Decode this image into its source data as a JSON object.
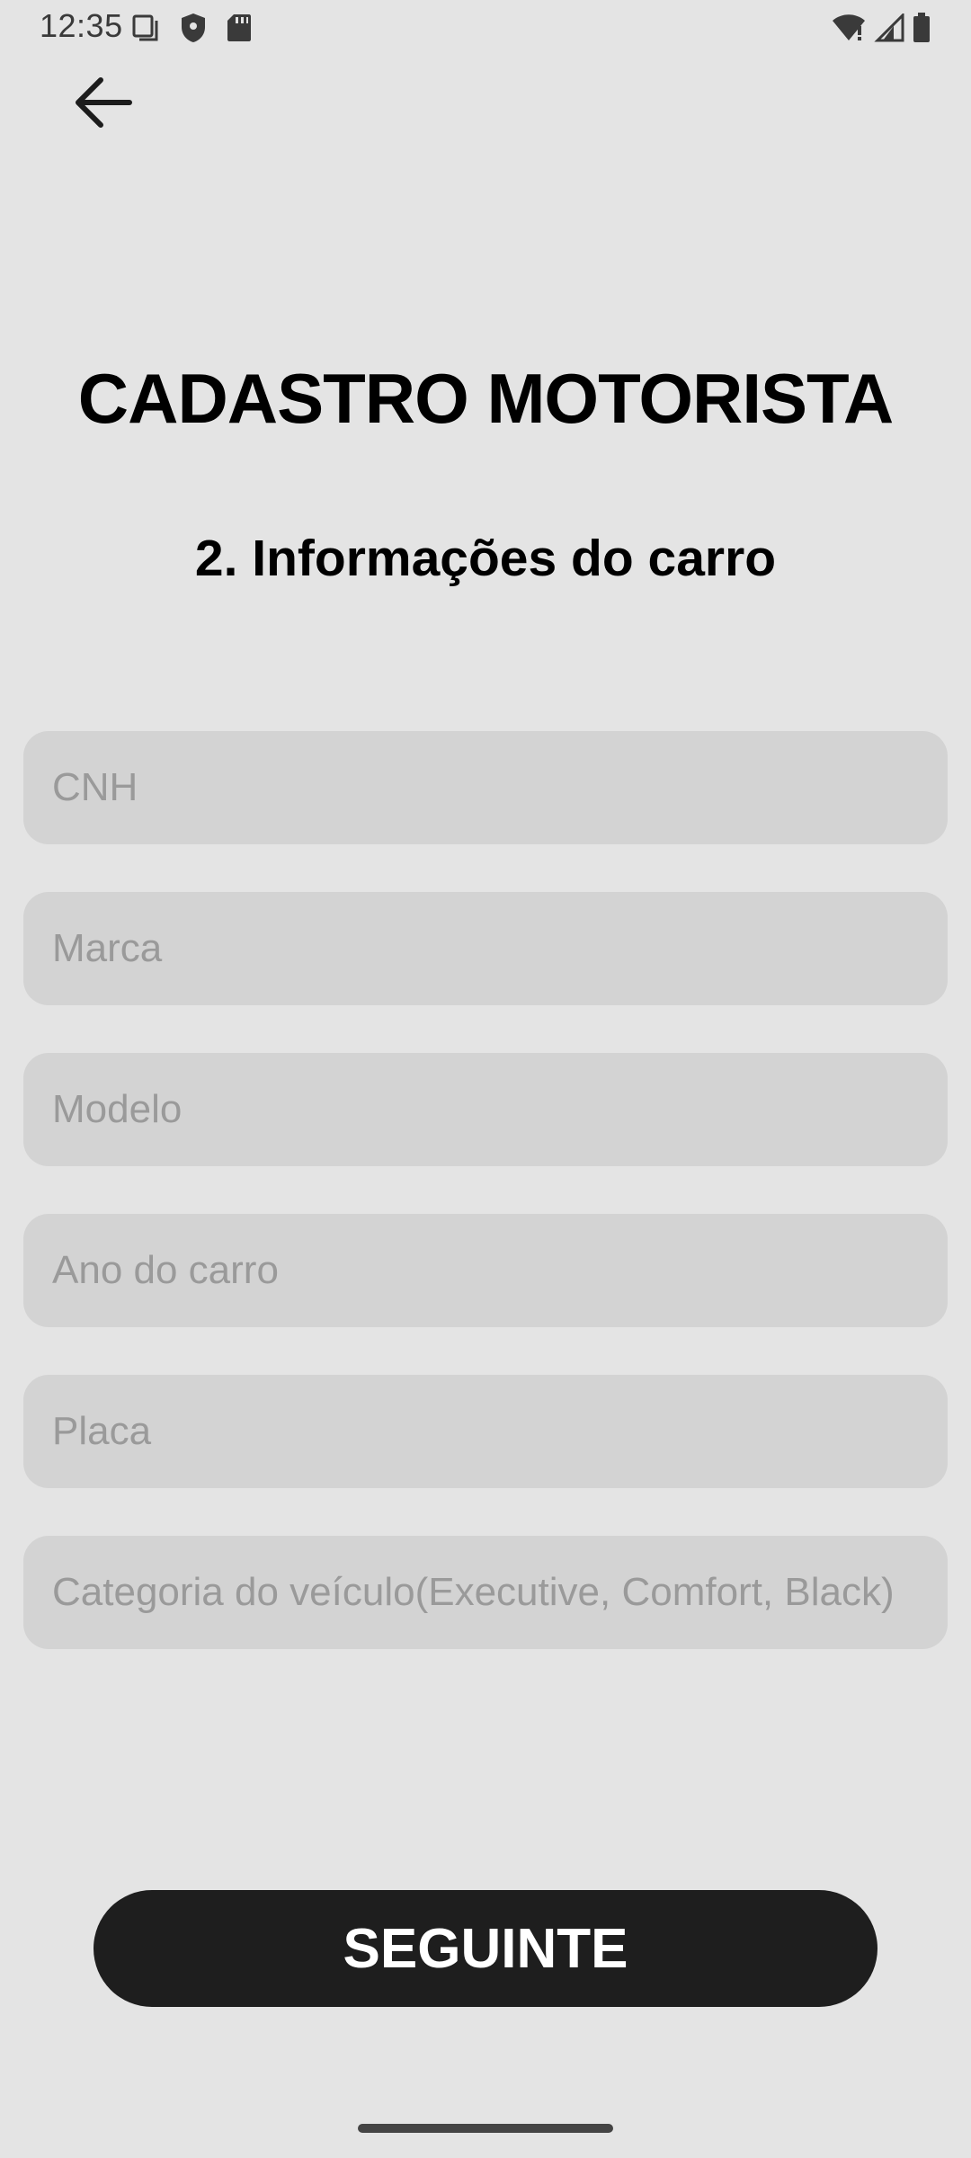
{
  "status_bar": {
    "time": "12:35",
    "left_icons": [
      "copy-icon",
      "shield-icon",
      "sd-card-icon"
    ],
    "right_icons": [
      "wifi-alert-icon",
      "signal-icon",
      "battery-icon"
    ]
  },
  "header": {
    "back_icon": "arrow-left-icon"
  },
  "title": "CADASTRO MOTORISTA",
  "subtitle": "2. Informações do carro",
  "form": {
    "cnh_placeholder": "CNH",
    "brand_placeholder": "Marca",
    "model_placeholder": "Modelo",
    "year_placeholder": "Ano do carro",
    "plate_placeholder": "Placa",
    "category_placeholder": "Categoria do veículo(Executive, Comfort, Black)"
  },
  "next_button_label": "SEGUINTE",
  "colors": {
    "background": "#e4e4e4",
    "field_background": "#d3d3d3",
    "placeholder": "#9a9a9a",
    "button_background": "#1e1e1e",
    "button_text": "#ffffff"
  }
}
